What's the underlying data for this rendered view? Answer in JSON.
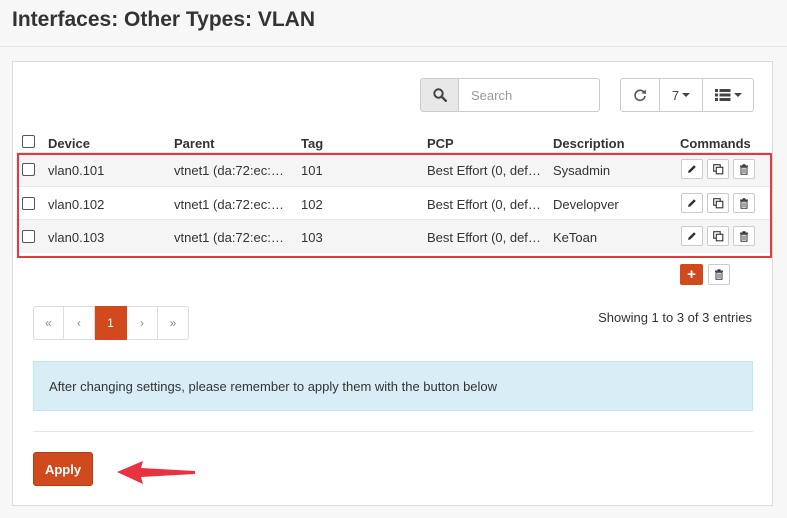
{
  "page": {
    "title": "Interfaces: Other Types: VLAN"
  },
  "toolbar": {
    "search_placeholder": "Search",
    "rows_per_page": "7"
  },
  "table": {
    "columns": [
      "Device",
      "Parent",
      "Tag",
      "PCP",
      "Description",
      "Commands"
    ],
    "rows": [
      {
        "device": "vlan0.101",
        "parent": "vtnet1 (da:72:ec:…",
        "tag": "101",
        "pcp": "Best Effort (0, def…",
        "description": "Sysadmin"
      },
      {
        "device": "vlan0.102",
        "parent": "vtnet1 (da:72:ec:…",
        "tag": "102",
        "pcp": "Best Effort (0, def…",
        "description": "Developver"
      },
      {
        "device": "vlan0.103",
        "parent": "vtnet1 (da:72:ec:…",
        "tag": "103",
        "pcp": "Best Effort (0, def…",
        "description": "KeToan"
      }
    ]
  },
  "pagination": {
    "first": "«",
    "prev": "‹",
    "current": "1",
    "next": "›",
    "last": "»",
    "info": "Showing 1 to 3 of 3 entries"
  },
  "alert": {
    "text": "After changing settings, please remember to apply them with the button below"
  },
  "apply": {
    "label": "Apply"
  },
  "colors": {
    "accent": "#d14a1e",
    "highlight": "#e53843",
    "alert_bg": "#d9edf7"
  },
  "icons": [
    "search-icon",
    "refresh-icon",
    "columns-list-icon",
    "edit-pencil-icon",
    "copy-icon",
    "trash-icon",
    "plus-icon",
    "arrow-left-icon"
  ]
}
